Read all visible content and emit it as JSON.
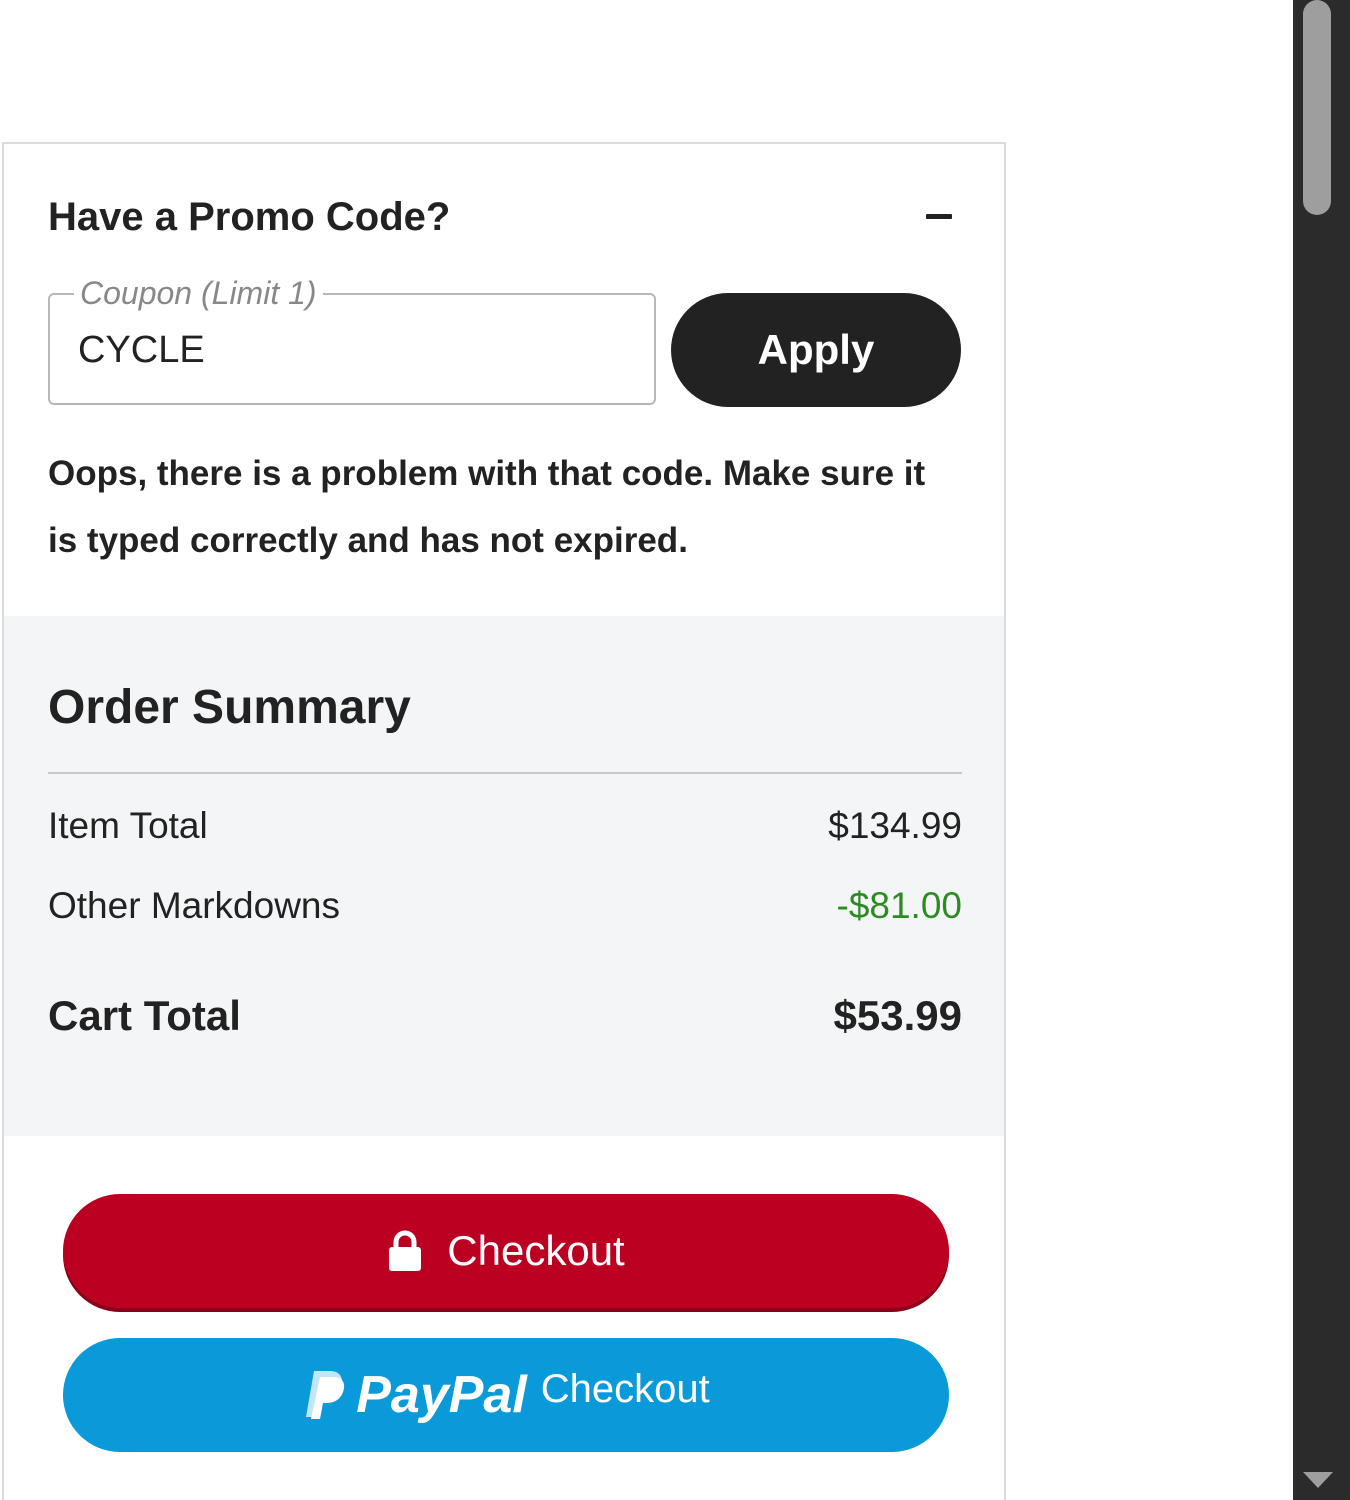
{
  "promo": {
    "title": "Have a Promo Code?",
    "toggle_icon": "minus-icon",
    "coupon_legend": "Coupon (Limit 1)",
    "coupon_value": "CYCLE",
    "apply_label": "Apply",
    "error_message": "Oops, there is a problem with that code. Make sure it is typed correctly and has not expired."
  },
  "summary": {
    "title": "Order Summary",
    "rows": [
      {
        "label": "Item Total",
        "value": "$134.99"
      },
      {
        "label": "Other Markdowns",
        "value": "-$81.00"
      },
      {
        "label": "Cart Total",
        "value": "$53.99"
      }
    ]
  },
  "actions": {
    "checkout_label": "Checkout",
    "checkout_icon": "lock-icon",
    "paypal_brand": "PayPal",
    "paypal_label": "Checkout",
    "paypal_icon": "paypal-icon"
  },
  "colors": {
    "checkout": "#bb0021",
    "paypal": "#0a9ad9",
    "apply": "#222222",
    "discount": "#2e8b24",
    "summary_bg": "#f4f5f7"
  }
}
